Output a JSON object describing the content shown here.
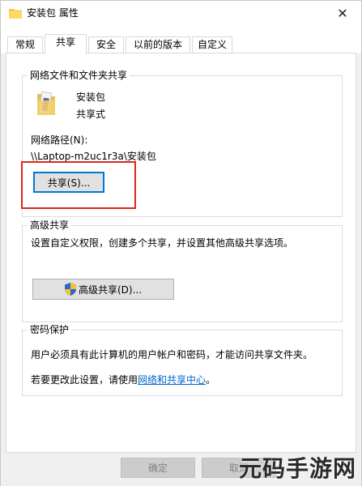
{
  "window": {
    "title": "安装包 属性",
    "close_label": "✕"
  },
  "tabs": [
    {
      "label": "常规",
      "active": false
    },
    {
      "label": "共享",
      "active": true
    },
    {
      "label": "安全",
      "active": false
    },
    {
      "label": "以前的版本",
      "active": false
    },
    {
      "label": "自定义",
      "active": false
    }
  ],
  "network_sharing": {
    "group_title": "网络文件和文件夹共享",
    "folder_name": "安装包",
    "folder_status": "共享式",
    "path_label": "网络路径(N):",
    "path_value": "\\\\Laptop-m2uc1r3a\\安装包",
    "share_button": "共享(S)..."
  },
  "advanced_sharing": {
    "group_title": "高级共享",
    "description": "设置自定义权限，创建多个共享，并设置其他高级共享选项。",
    "button": "高级共享(D)..."
  },
  "password_protection": {
    "group_title": "密码保护",
    "description": "用户必须具有此计算机的用户帐户和密码，才能访问共享文件夹。",
    "change_prefix": "若要更改此设置，请使用",
    "change_link": "网络和共享中心",
    "change_suffix": "。"
  },
  "footer": {
    "ok_button": "确定",
    "cancel_button": "取消"
  },
  "watermark": "元码手游网",
  "colors": {
    "accent": "#0078d7",
    "highlight": "#d9281e",
    "link": "#0066cc"
  }
}
